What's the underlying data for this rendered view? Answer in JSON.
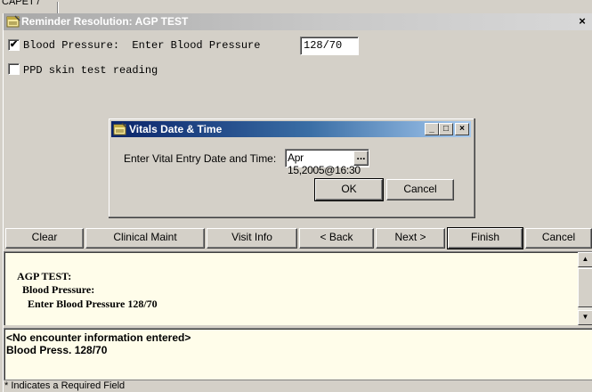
{
  "background_fragment": {
    "text": "CAPET /"
  },
  "window": {
    "title": "Reminder Resolution: AGP TEST",
    "close_glyph": "×"
  },
  "prompts": [
    {
      "checked": true,
      "check_glyph": "✔",
      "label": "Blood Pressure:  Enter Blood Pressure",
      "value": "128/70"
    },
    {
      "checked": false,
      "check_glyph": "",
      "label": "PPD skin test reading"
    }
  ],
  "dialog": {
    "title": "Vitals Date & Time",
    "minimize_glyph": "_",
    "maximize_glyph": "□",
    "close_glyph": "×",
    "label": "Enter Vital Entry Date and Time:",
    "value": "Apr 15,2005@16:30",
    "browse_label": "...",
    "ok_label": "OK",
    "cancel_label": "Cancel"
  },
  "buttons": {
    "clear": "Clear",
    "clinical_maint": "Clinical Maint",
    "visit_info": "Visit Info",
    "back": "< Back",
    "next": "Next >",
    "finish": "Finish",
    "cancel": "Cancel"
  },
  "preview": {
    "lines": [
      "AGP TEST:",
      "  Blood Pressure:",
      "    Enter Blood Pressure 128/70"
    ],
    "scroll_up": "▲",
    "scroll_down": "▼"
  },
  "encounter": {
    "line1": "<No encounter information entered>",
    "line2": "Blood Press. 128/70"
  },
  "status": {
    "text": "* Indicates a Required Field"
  }
}
